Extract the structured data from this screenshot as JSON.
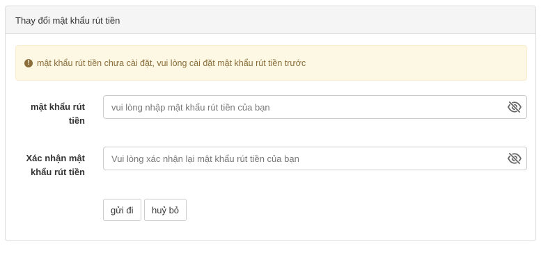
{
  "panel": {
    "title": "Thay đổi mật khẩu rút tiền"
  },
  "alert": {
    "icon": "exclamation-circle-icon",
    "message": "mật khẩu rút tiền chưa cài đặt, vui lòng cài đặt mật khẩu rút tiền trước",
    "color": "#8a6d3b",
    "background": "#fcf8e3"
  },
  "form": {
    "password": {
      "label_line1": "mật khẩu rút",
      "label_line2": "tiền",
      "value": "",
      "placeholder": "vui lòng nhập mật khẩu rút tiền của bạn",
      "toggle_icon": "eye-slash-icon"
    },
    "confirm": {
      "label_line1": "Xác nhận mật",
      "label_line2": "khẩu rút tiền",
      "value": "",
      "placeholder": "Vui lòng xác nhận lại mật khẩu rút tiền của bạn",
      "toggle_icon": "eye-slash-icon"
    },
    "submit_label": "gửi đi",
    "cancel_label": "huỷ bỏ"
  }
}
